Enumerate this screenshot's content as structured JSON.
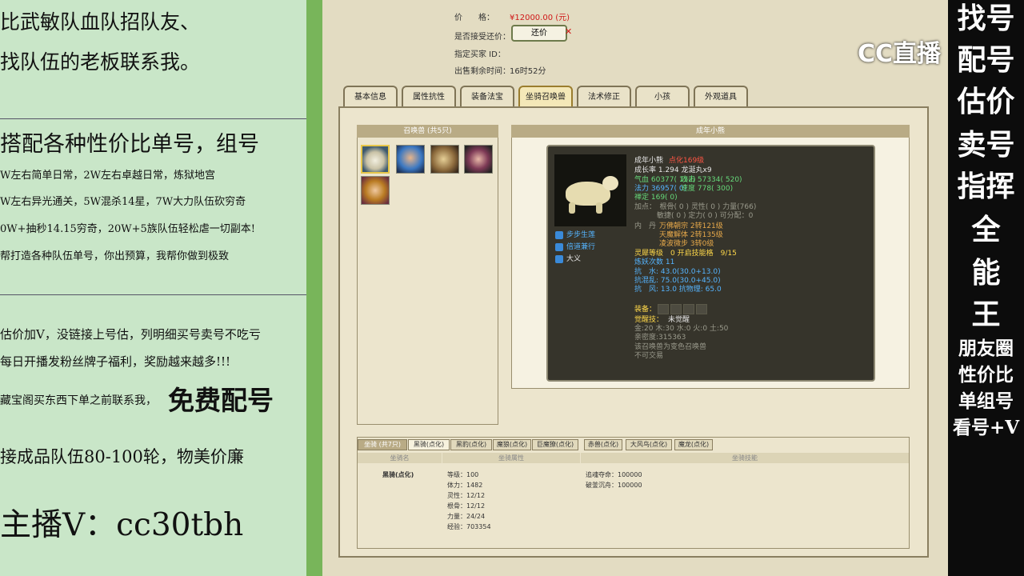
{
  "left_panel": {
    "lines": [
      "比武敏队血队招队友、",
      "找队伍的老板联系我。",
      "搭配各种性价比单号，组号",
      "W左右简单日常，2W左右卓越日常，炼狱地宫",
      "W左右异光通关，5W混杀14星，7W大力队伍砍穷奇",
      "0W+抽秒14.15穷奇，20W+5族队伍轻松虐一切副本!",
      "帮打造各种队伍单号，你出预算，我帮你做到极致",
      "估价加V，没链接上号估，列明细买号卖号不吃亏",
      "每日开播发粉丝牌子福利，奖励越来越多!!!",
      "藏宝阁买东西下单之前联系我，",
      "免费配号",
      "接成品队伍80-100轮，物美价廉",
      "主播V：cc30tbh"
    ]
  },
  "right_panel": {
    "big": [
      "找号",
      "配号",
      "估价",
      "卖号",
      "指挥",
      "全",
      "能",
      "王"
    ],
    "small": [
      "朋友圈",
      "性价比",
      "单组号",
      "看号+V"
    ]
  },
  "logo": "CC直播",
  "info": {
    "price_label": "价　　格：",
    "price_value": "¥12000.00 (元)",
    "bargain_label": "是否接受还价：",
    "bargain_button": "还价",
    "buyer_label": "指定买家 ID：",
    "time_label": "出售剩余时间：",
    "time_value": "16时52分"
  },
  "tabs": [
    "基本信息",
    "属性抗性",
    "装备法宝",
    "坐骑召唤兽",
    "法术修正",
    "小孩",
    "外观道具"
  ],
  "summon_list_title": "召唤兽 (共5只)",
  "detail_title": "成年小熊",
  "tooltip": {
    "name": "成年小熊",
    "tag": "点化169级",
    "growth": "成长率 1.294 龙涎丸x9",
    "hp": "气血 60377( 152)",
    "attack": "攻击 57334( 520)",
    "mp": "法力 36957( 0)",
    "speed": "速度 778( 300)",
    "calm": "禅定 169( 0)",
    "points1": "加点：　根骨( 0 ) 灵性( 0 ) 力量(766)",
    "points2": "敏捷( 0 ) 定力( 0 ) 可分配：0",
    "dan_label": "内　丹",
    "dan1": "万佛朝宗 2转121级",
    "dan2": "天魔解体 2转135级",
    "dan3": "凌波微步 3转0级",
    "skills": [
      "步步生莲",
      "倍道兼行",
      "大义"
    ],
    "lingxi": "灵犀等级　0 开启技能格　9/15",
    "yao": "炼妖次数 11",
    "res1": "抗　水: 43.0(30.0+13.0)",
    "res2": "抗混乱: 75.0(30.0+45.0)",
    "res3": "抗　风: 13.0 抗物理: 65.0",
    "equip_label": "装备：",
    "awaken_label": "觉醒技：",
    "awaken_value": "未觉醒",
    "elements": "金:20 木:30 水:0 火:0 土:50",
    "intimacy": "亲密度:315363",
    "note1": "该召唤兽为变色召唤兽",
    "note2": "不可交易"
  },
  "bottom": {
    "tabs": [
      "坐骑 (共7只)",
      "黑骑(点化)",
      "黑豹(点化)",
      "魔狼(点化)",
      "巨魔獠(点化)",
      "赤兽(点化)",
      "大风鸟(点化)",
      "魔龙(点化)"
    ],
    "cols": [
      "坐骑名",
      "坐骑属性",
      "坐骑技能"
    ],
    "name": "黑骑(点化)",
    "stats": [
      "等级：100",
      "体力：1482",
      "灵性：12/12",
      "根骨：12/12",
      "力量：24/24",
      "经验：703354"
    ],
    "skills": [
      "追魂夺命：100000",
      "破釜沉舟：100000"
    ]
  }
}
